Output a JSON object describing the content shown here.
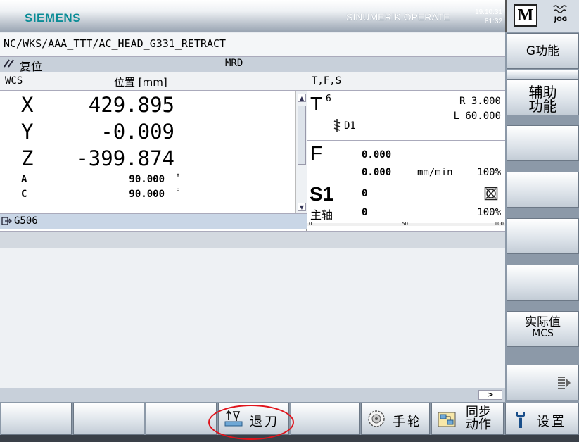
{
  "header": {
    "logo": "SIEMENS",
    "product": "SINUMERIK OPERATE",
    "date": "19.10.31",
    "time": "81:32",
    "mode_m": "M",
    "mode_jog": "JOG"
  },
  "program": {
    "path": "NC/WKS/AAA_TTT/AC_HEAD_G331_RETRACT",
    "status": "复位",
    "mrd": "MRD"
  },
  "axes": {
    "wcs_label": "WCS",
    "position_label": "位置 [mm]",
    "rows": [
      {
        "name": "X",
        "value": "429.895"
      },
      {
        "name": "Y",
        "value": "-0.009"
      },
      {
        "name": "Z",
        "value": "-399.874"
      },
      {
        "name": "A",
        "value": "90.000"
      },
      {
        "name": "C",
        "value": "90.000"
      }
    ],
    "deg_symbol": "°",
    "g_code": "G506"
  },
  "tfs": {
    "label": "T,F,S",
    "t_letter": "T",
    "t_number": "6",
    "r_value": "R 3.000",
    "l_value": "L 60.000",
    "d_value": "D1",
    "f_letter": "F",
    "f_value1": "0.000",
    "f_value2": "0.000",
    "f_unit": "mm/min",
    "f_override": "100%",
    "s_letter": "S1",
    "s_value1": "0",
    "spindle_label": "主轴",
    "s_value2": "0",
    "s_override": "100%",
    "tick_0": "0",
    "tick_50": "50",
    "tick_100": "100"
  },
  "right_softkeys": {
    "g_function": "G功能",
    "aux_line1": "辅助",
    "aux_line2": "功能",
    "actual_line1": "实际值",
    "actual_line2": "MCS"
  },
  "bottom_softkeys": {
    "retract": "退刀",
    "handwheel": "手轮",
    "sync_line1": "同步",
    "sync_line2": "动作",
    "settings": "设置"
  },
  "hscroll_arrow": ">",
  "colors": {
    "logo": "#0a8c96",
    "highlight": "#e0141c",
    "softkey_bg": "#dfe5eb"
  }
}
